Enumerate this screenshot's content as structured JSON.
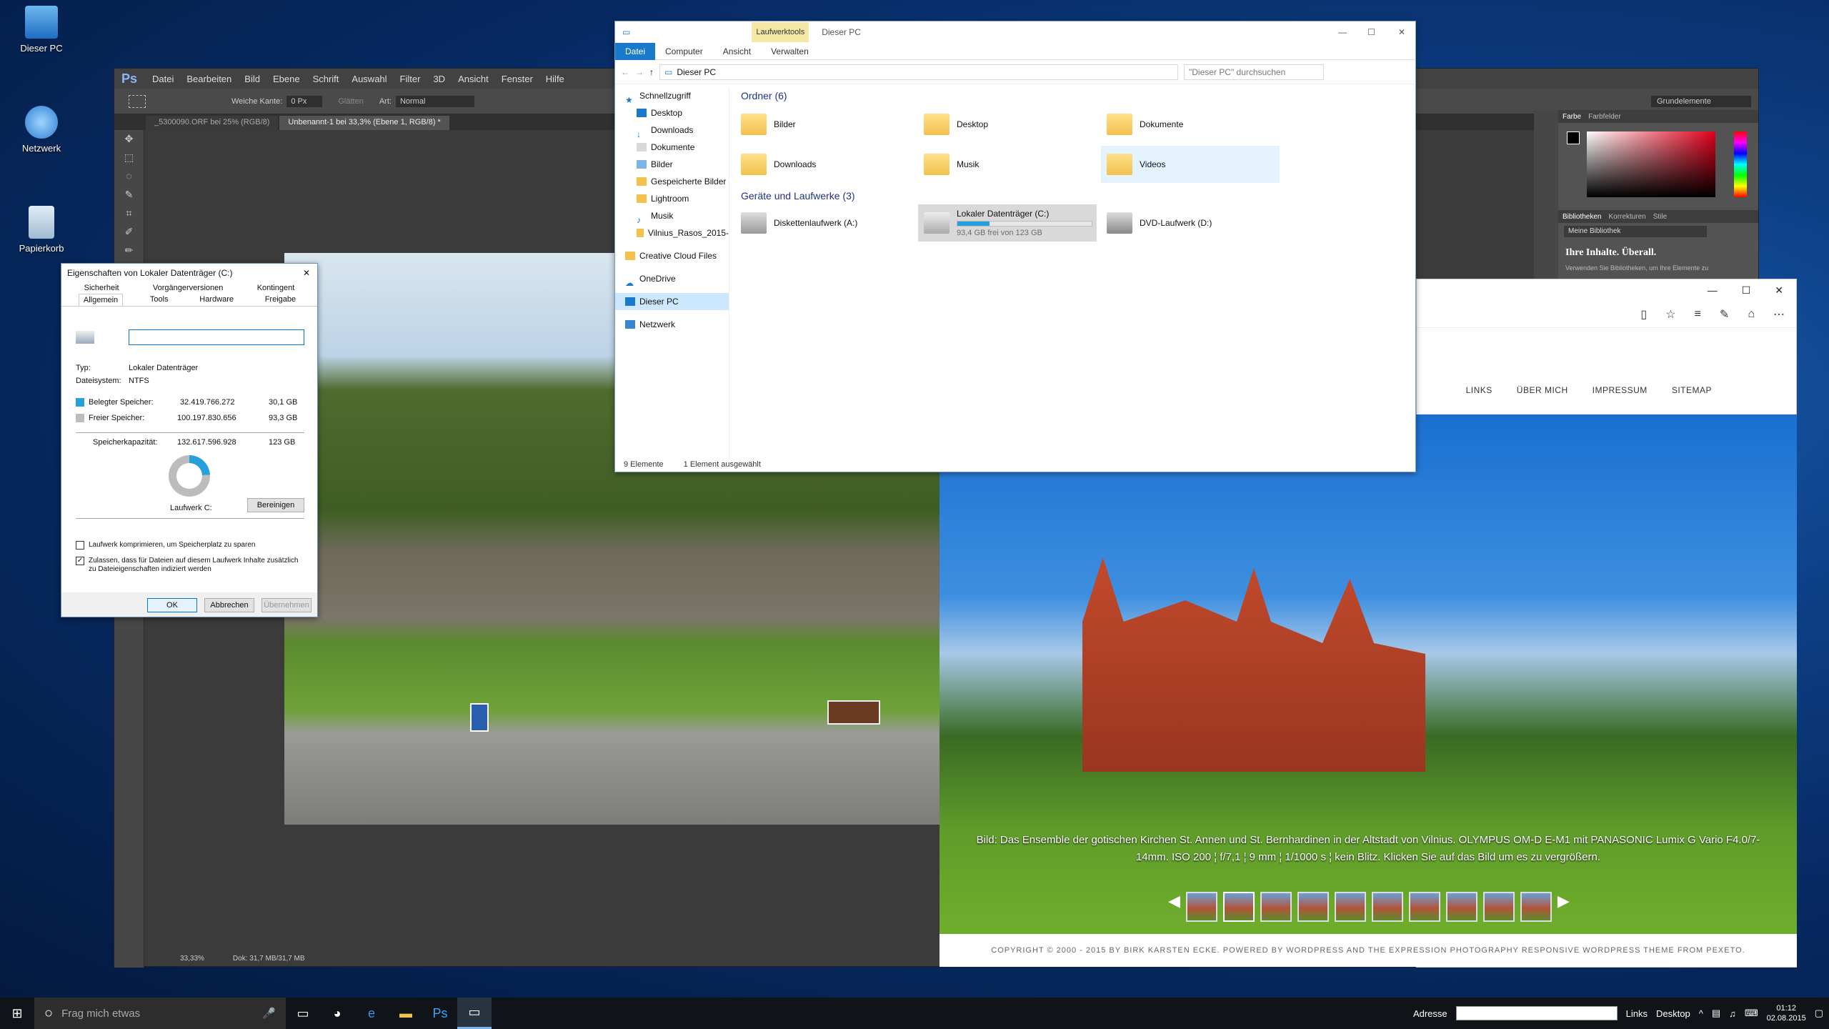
{
  "desktop": {
    "icons": [
      {
        "label": "Dieser PC",
        "icon": "computer-icon"
      },
      {
        "label": "Netzwerk",
        "icon": "network-icon"
      },
      {
        "label": "Papierkorb",
        "icon": "recycle-bin-icon"
      }
    ]
  },
  "photoshop": {
    "logo": "Ps",
    "menu": [
      "Datei",
      "Bearbeiten",
      "Bild",
      "Ebene",
      "Schrift",
      "Auswahl",
      "Filter",
      "3D",
      "Ansicht",
      "Fenster",
      "Hilfe"
    ],
    "options": {
      "feather_label": "Weiche Kante:",
      "feather_value": "0 Px",
      "smooth_label": "Glätten",
      "style_label": "Art:",
      "style_value": "Normal"
    },
    "tabs": [
      "_5300090.ORF bei 25% (RGB/8)",
      "Unbenannt-1 bei 33,3% (Ebene 1, RGB/8) *"
    ],
    "workspace": "Grundelemente",
    "panel_tabs": [
      "Farbe",
      "Farbfelder"
    ],
    "library_tabs": [
      "Bibliotheken",
      "Korrekturen",
      "Stile"
    ],
    "library_name": "Meine Bibliothek",
    "library_heading": "Ihre Inhalte. Überall.",
    "library_text": "Verwenden Sie Bibliotheken, um Ihre Elemente zu",
    "status_zoom": "33,33%",
    "status_doc": "Dok: 31,7 MB/31,7 MB"
  },
  "explorer": {
    "title": "Dieser PC",
    "ribbon_context": "Laufwerktools",
    "ribbon_tabs": [
      "Datei",
      "Computer",
      "Ansicht",
      "Verwalten"
    ],
    "address": "Dieser PC",
    "search_placeholder": "\"Dieser PC\" durchsuchen",
    "nav": [
      "Schnellzugriff",
      "Desktop",
      "Downloads",
      "Dokumente",
      "Bilder",
      "Gespeicherte Bilder",
      "Lightroom",
      "Musik",
      "Vilnius_Rasos_2015-",
      "Creative Cloud Files",
      "OneDrive",
      "Dieser PC",
      "Netzwerk"
    ],
    "group_folders": "Ordner (6)",
    "folders": [
      "Bilder",
      "Desktop",
      "Dokumente",
      "Downloads",
      "Musik",
      "Videos"
    ],
    "group_drives": "Geräte und Laufwerke (3)",
    "drives": [
      {
        "name": "Diskettenlaufwerk (A:)",
        "detail": ""
      },
      {
        "name": "Lokaler Datenträger (C:)",
        "detail": "93,4 GB frei von 123 GB",
        "used_fraction": 0.24
      },
      {
        "name": "DVD-Laufwerk (D:)",
        "detail": ""
      }
    ],
    "status_count": "9 Elemente",
    "status_selected": "1 Element ausgewählt"
  },
  "properties": {
    "title": "Eigenschaften von Lokaler Datenträger (C:)",
    "tabs_row1": [
      "Sicherheit",
      "Vorgängerversionen",
      "Kontingent"
    ],
    "tabs_row2": [
      "Allgemein",
      "Tools",
      "Hardware",
      "Freigabe"
    ],
    "name_value": "",
    "type_label": "Typ:",
    "type_value": "Lokaler Datenträger",
    "fs_label": "Dateisystem:",
    "fs_value": "NTFS",
    "used_label": "Belegter Speicher:",
    "used_bytes": "32.419.766.272",
    "used_gb": "30,1 GB",
    "free_label": "Freier Speicher:",
    "free_bytes": "100.197.830.656",
    "free_gb": "93,3 GB",
    "cap_label": "Speicherkapazität:",
    "cap_bytes": "132.617.596.928",
    "cap_gb": "123 GB",
    "drive_label": "Laufwerk C:",
    "cleanup": "Bereinigen",
    "compress": "Laufwerk komprimieren, um Speicherplatz zu sparen",
    "index": "Zulassen, dass für Dateien auf diesem Laufwerk Inhalte zusätzlich zu Dateieigenschaften indiziert werden",
    "ok": "OK",
    "cancel": "Abbrechen",
    "apply": "Übernehmen",
    "colors": {
      "used": "#26a0da",
      "free": "#bcbcbc"
    }
  },
  "browser": {
    "nav": [
      "LINKS",
      "ÜBER MICH",
      "IMPRESSUM",
      "SITEMAP"
    ],
    "caption": "Bild: Das Ensemble der gotischen Kirchen St. Annen und St. Bernhardinen in der Altstadt von Vilnius. OLYMPUS OM-D E-M1 mit PANASONIC Lumix G Vario F4.0/7-14mm. ISO 200 ¦ f/7,1 ¦ 9 mm ¦ 1/1000 s ¦ kein Blitz. Klicken Sie auf das Bild um es zu vergrößern.",
    "footer": "COPYRIGHT © 2000 - 2015 BY BIRK KARSTEN ECKE. POWERED BY WORDPRESS AND THE EXPRESSION PHOTOGRAPHY RESPONSIVE WORDPRESS THEME FROM PEXETO."
  },
  "taskbar": {
    "search_placeholder": "Frag mich etwas",
    "address_label": "Adresse",
    "links": "Links",
    "desktop": "Desktop",
    "time": "01:12",
    "date": "02.08.2015"
  }
}
